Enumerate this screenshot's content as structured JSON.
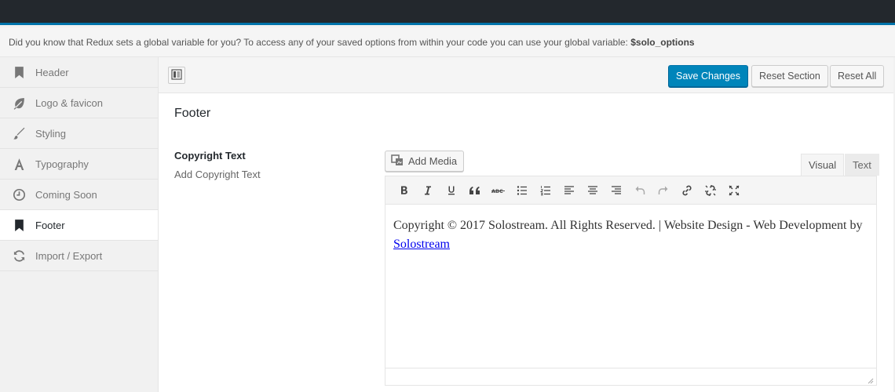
{
  "notice": {
    "text": "Did you know that Redux sets a global variable for you? To access any of your saved options from within your code you can use your global variable:",
    "variable": "$solo_options"
  },
  "sidebar": {
    "items": [
      {
        "label": "Header",
        "icon": "bookmark-icon",
        "active": false
      },
      {
        "label": "Logo & favicon",
        "icon": "leaf-icon",
        "active": false
      },
      {
        "label": "Styling",
        "icon": "brush-icon",
        "active": false
      },
      {
        "label": "Typography",
        "icon": "typography-icon",
        "active": false
      },
      {
        "label": "Coming Soon",
        "icon": "clock-icon",
        "active": false
      },
      {
        "label": "Footer",
        "icon": "bookmark-icon",
        "active": true
      },
      {
        "label": "Import / Export",
        "icon": "refresh-icon",
        "active": false
      }
    ]
  },
  "toolbar": {
    "save_label": "Save Changes",
    "reset_section_label": "Reset Section",
    "reset_all_label": "Reset All"
  },
  "section": {
    "title": "Footer"
  },
  "field": {
    "title": "Copyright Text",
    "subtitle": "Add Copyright Text"
  },
  "editor": {
    "add_media_label": "Add Media",
    "tab_visual": "Visual",
    "tab_text": "Text",
    "content_text": "Copyright © 2017 Solostream. All Rights Reserved. | Website Design - Web Development by",
    "content_link": "Solostream",
    "toolbar_buttons": [
      "bold",
      "italic",
      "underline",
      "blockquote",
      "strikethrough",
      "bullet-list",
      "numbered-list",
      "align-left",
      "align-center",
      "align-right",
      "undo",
      "redo",
      "link",
      "unlink",
      "fullscreen"
    ]
  },
  "colors": {
    "primary": "#0085ba",
    "admin_bar": "#23282d",
    "admin_accent": "#0073aa"
  }
}
